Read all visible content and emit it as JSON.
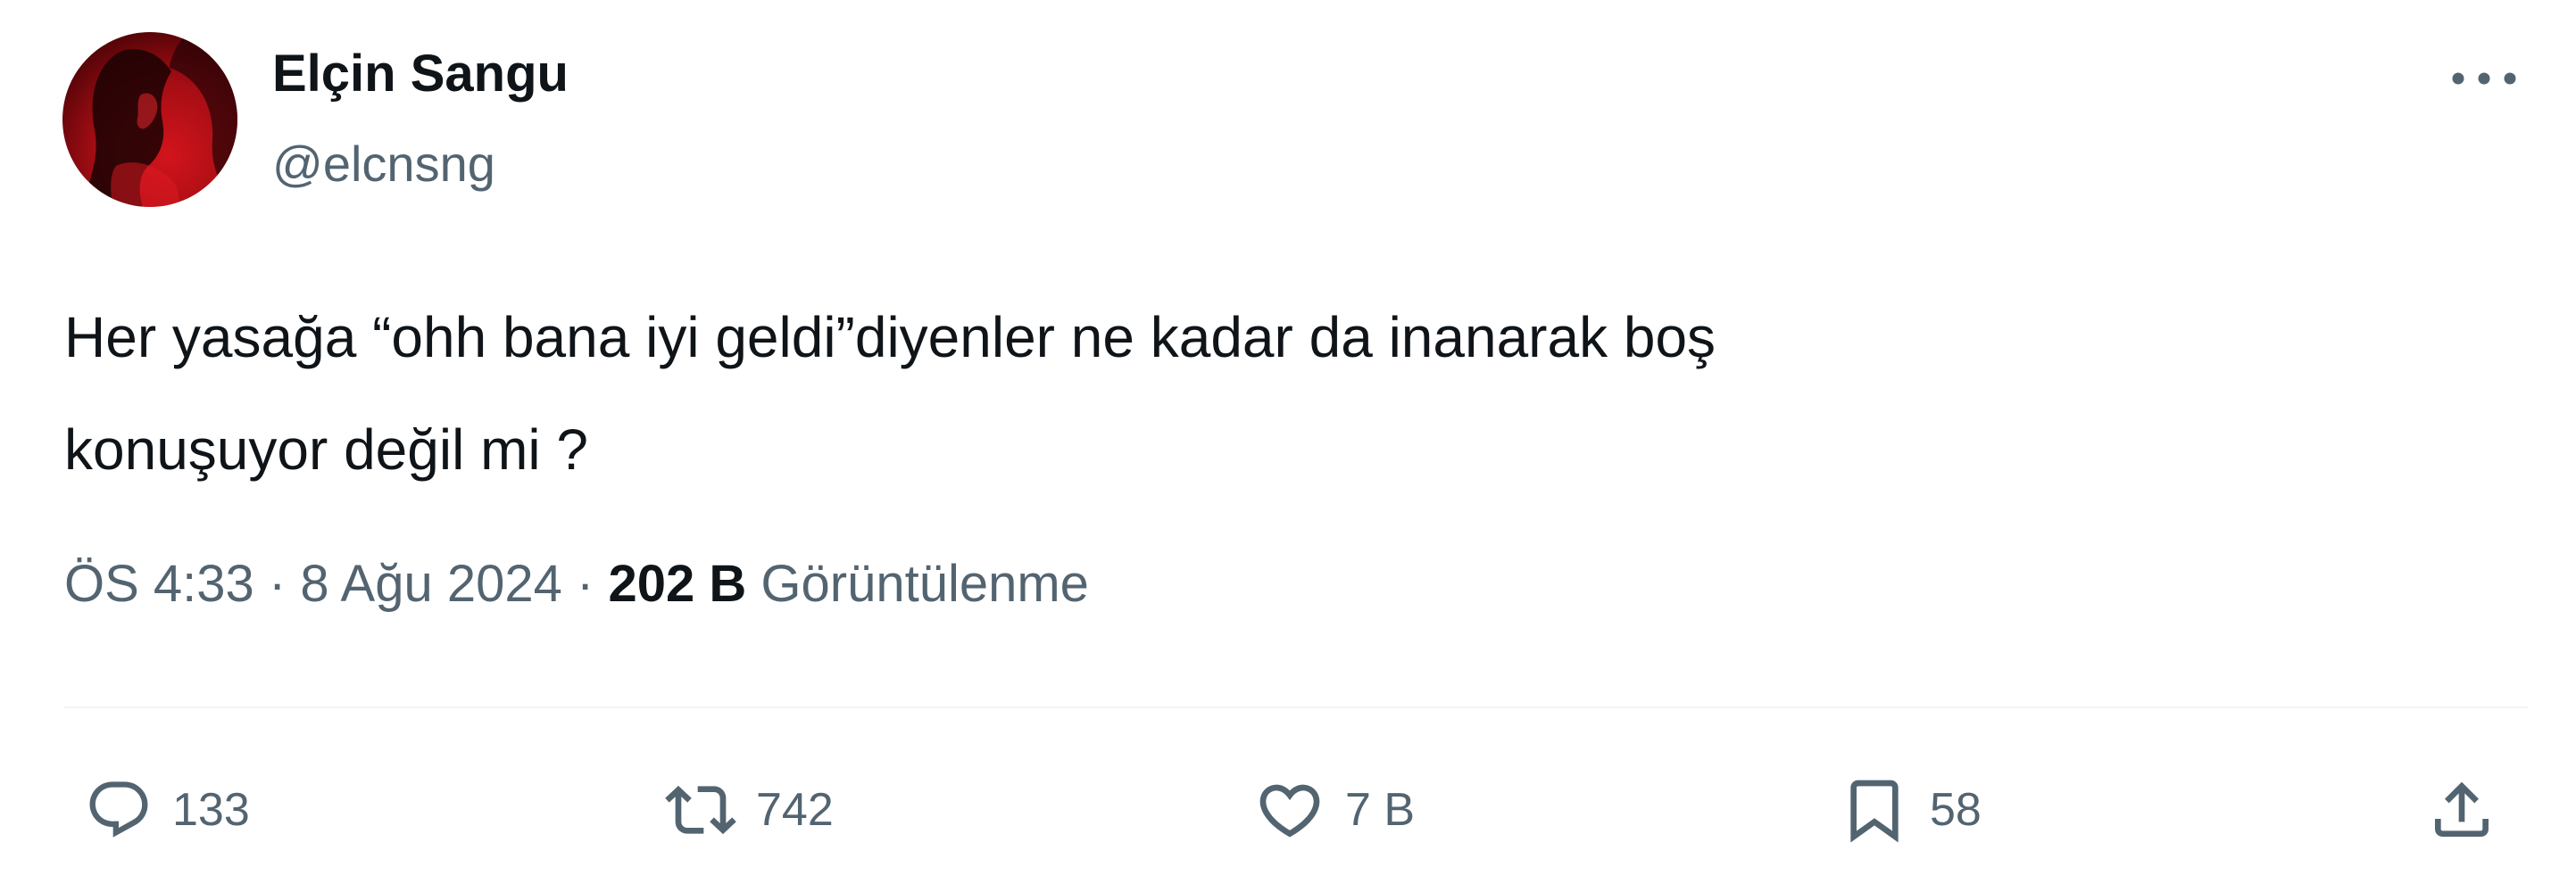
{
  "author": {
    "display_name": "Elçin Sangu",
    "handle": "@elcnsng"
  },
  "tweet": {
    "text_lines": [
      "Her yasağa “ohh bana iyi geldi”diyenler ne kadar da inanarak boş",
      "konuşuyor değil mi ?"
    ],
    "time": "ÖS 4:33",
    "date": "8 Ağu 2024",
    "separator": "·",
    "views_count": "202 B",
    "views_label": "Görüntülenme"
  },
  "actions": {
    "replies": "133",
    "reposts": "742",
    "likes": "7 B",
    "bookmarks": "58"
  },
  "icons": {
    "more": "more-horizontal-icon",
    "reply": "speech-bubble-icon",
    "repost": "repost-arrows-icon",
    "like": "heart-icon",
    "bookmark": "bookmark-icon",
    "share": "share-upload-icon"
  },
  "colors": {
    "text_primary": "#0f1419",
    "text_secondary": "#536471",
    "divider": "#eff3f4",
    "avatar_red": "#c8121a"
  }
}
